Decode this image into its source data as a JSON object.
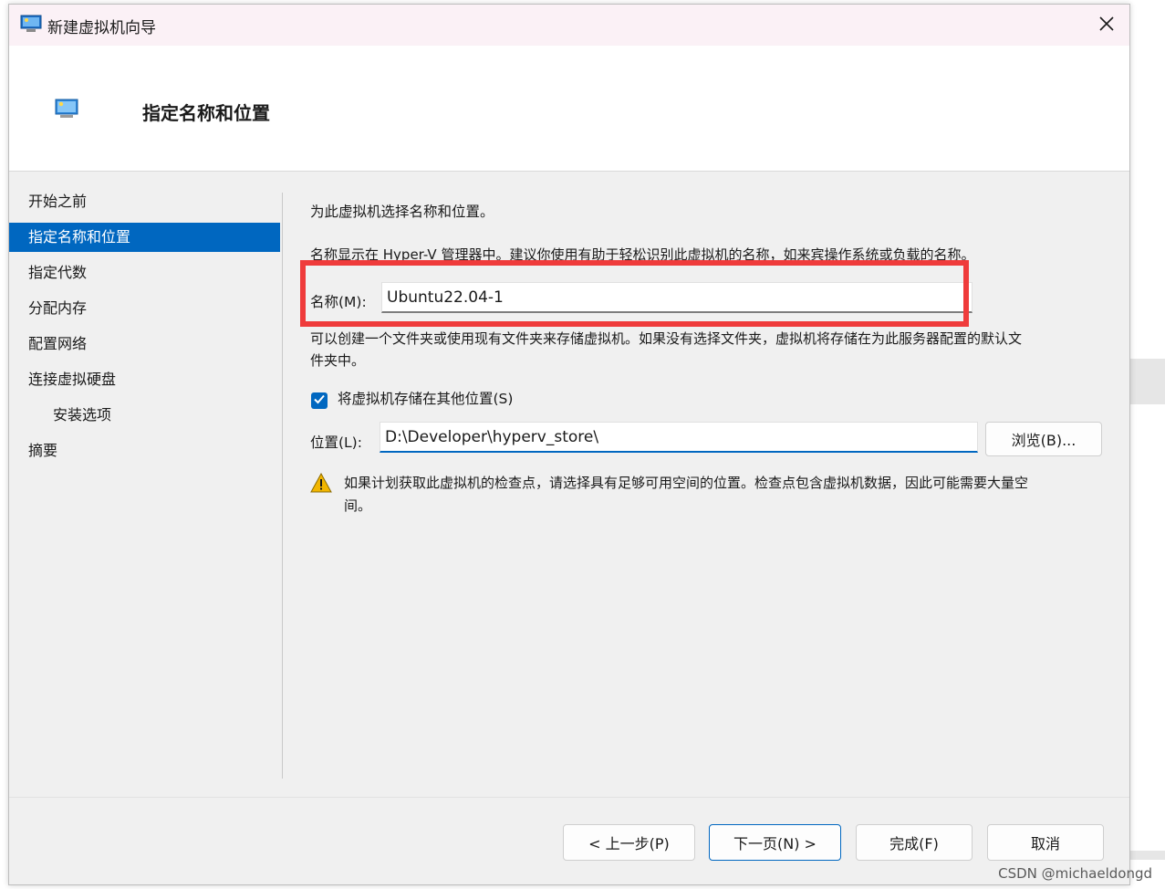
{
  "window": {
    "title": "新建虚拟机向导",
    "heading": "指定名称和位置"
  },
  "sidebar": {
    "items": [
      {
        "label": "开始之前"
      },
      {
        "label": "指定名称和位置"
      },
      {
        "label": "指定代数"
      },
      {
        "label": "分配内存"
      },
      {
        "label": "配置网络"
      },
      {
        "label": "连接虚拟硬盘"
      },
      {
        "label": "安装选项"
      },
      {
        "label": "摘要"
      }
    ]
  },
  "main": {
    "intro": "为此虚拟机选择名称和位置。",
    "name_desc": "名称显示在 Hyper-V 管理器中。建议你使用有助于轻松识别此虚拟机的名称，如来宾操作系统或负载的名称。",
    "name_label": "名称(M):",
    "name_value": "Ubuntu22.04-1",
    "folder_desc_line1": "可以创建一个文件夹或使用现有文件夹来存储虚拟机。如果没有选择文件夹，虚拟机将存储在为此服务器配置的默认文",
    "folder_desc_line2": "件夹中。",
    "store_checkbox_label": "将虚拟机存储在其他位置(S)",
    "store_checked": true,
    "location_label": "位置(L):",
    "location_value": "D:\\Developer\\hyperv_store\\",
    "browse_label": "浏览(B)...",
    "warning_line1": "如果计划获取此虚拟机的检查点，请选择具有足够可用空间的位置。检查点包含虚拟机数据，因此可能需要大量空",
    "warning_line2": "间。"
  },
  "footer": {
    "prev_label": "< 上一步(P)",
    "next_label": "下一页(N) >",
    "finish_label": "完成(F)",
    "cancel_label": "取消"
  },
  "watermark": "CSDN @michaeldongd",
  "colors": {
    "accent": "#0067c0",
    "highlight": "#ef3b3b",
    "warning": "#f2b600"
  }
}
